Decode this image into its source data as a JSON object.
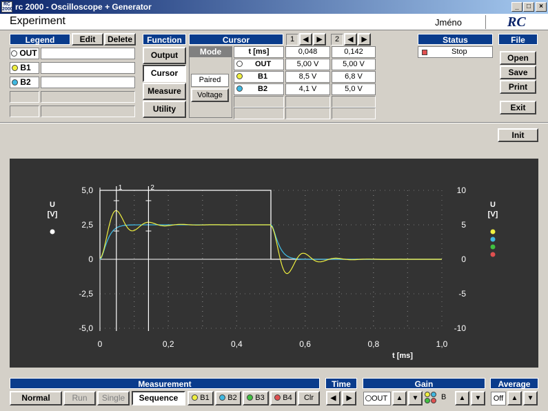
{
  "window": {
    "title": "rc 2000 - Oscilloscope + Generator",
    "app_icon": "RC 2000",
    "controls": [
      "_",
      "□",
      "×"
    ]
  },
  "header": {
    "experiment": "Experiment",
    "user": "Jméno",
    "logo": "RC"
  },
  "legend": {
    "title": "Legend",
    "edit": "Edit",
    "delete": "Delete",
    "rows": [
      {
        "label": "OUT",
        "color": "#ffffff"
      },
      {
        "label": "B1",
        "color": "#f0f040"
      },
      {
        "label": "B2",
        "color": "#40b8e0"
      }
    ]
  },
  "function": {
    "title": "Function",
    "buttons": [
      "Output",
      "Cursor",
      "Measure",
      "Utility"
    ],
    "active": "Cursor"
  },
  "cursor": {
    "title": "Cursor",
    "mode_label": "Mode",
    "mode_paired": "Paired",
    "mode_voltage": "Voltage",
    "num1": "1",
    "num2": "2",
    "rows": [
      {
        "label": "t  [ms]",
        "v1": "0,048",
        "v2": "0,142"
      },
      {
        "label": "OUT",
        "v1": "5,00 V",
        "v2": "5,00 V",
        "color": "#ffffff"
      },
      {
        "label": "B1",
        "v1": "8,5 V",
        "v2": "6,8 V",
        "color": "#f0f040"
      },
      {
        "label": "B2",
        "v1": "4,1 V",
        "v2": "5,0 V",
        "color": "#40b8e0"
      }
    ]
  },
  "status": {
    "title": "Status",
    "value": "Stop",
    "color": "#e05050"
  },
  "file": {
    "title": "File",
    "buttons": [
      "Open",
      "Save",
      "Print",
      "Exit"
    ]
  },
  "init_label": "Init",
  "chart_data": {
    "type": "line",
    "xlabel": "t [ms]",
    "ylabel_left": "U\n[V]",
    "ylabel_right": "U\n[V]",
    "xlim": [
      0,
      1
    ],
    "ylim_left": [
      -5,
      5
    ],
    "ylim_right": [
      -10,
      10
    ],
    "x_ticks": [
      "0",
      "0,2",
      "0,4",
      "0,6",
      "0,8",
      "1,0"
    ],
    "y_ticks_left": [
      "5,0",
      "2,5",
      "0",
      "-2,5",
      "-5,0"
    ],
    "y_ticks_right": [
      "10",
      "5",
      "0",
      "-5",
      "-10"
    ],
    "cursors": [
      {
        "label": "1",
        "t": 0.048
      },
      {
        "label": "2",
        "t": 0.142
      }
    ],
    "series": [
      {
        "name": "OUT",
        "color": "#ffffff",
        "x": [
          0,
          0,
          0.5,
          0.5,
          1
        ],
        "y": [
          0,
          5,
          5,
          0,
          0
        ]
      },
      {
        "name": "B1",
        "color": "#f0f040",
        "note_axis": "left"
      },
      {
        "name": "B2",
        "color": "#40b8e0"
      }
    ],
    "right_dots": [
      "#f0f040",
      "#40b8e0",
      "#40c040",
      "#e05050"
    ],
    "left_dot": "#ffffff"
  },
  "bottom": {
    "measurement": {
      "title": "Measurement",
      "buttons": [
        "Normal",
        "Run",
        "Single",
        "Sequence"
      ],
      "channels": [
        {
          "label": "B1",
          "color": "#f0f040"
        },
        {
          "label": "B2",
          "color": "#40b8e0"
        },
        {
          "label": "B3",
          "color": "#40c040"
        },
        {
          "label": "B4",
          "color": "#e05050"
        }
      ],
      "clr": "Clr"
    },
    "time": {
      "title": "Time"
    },
    "gain": {
      "title": "Gain",
      "out": "OUT",
      "b": "B"
    },
    "average": {
      "title": "Average",
      "value": "Off"
    }
  }
}
